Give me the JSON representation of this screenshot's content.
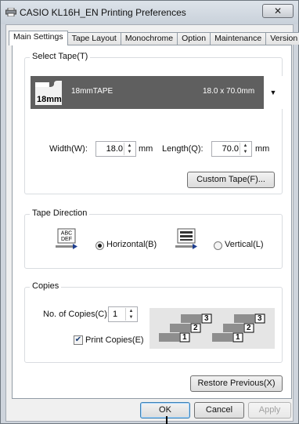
{
  "window": {
    "title": "CASIO KL16H_EN Printing Preferences",
    "close_label": "✕"
  },
  "tabs": [
    {
      "label": "Main Settings",
      "active": true
    },
    {
      "label": "Tape Layout",
      "active": false
    },
    {
      "label": "Monochrome",
      "active": false
    },
    {
      "label": "Option",
      "active": false
    },
    {
      "label": "Maintenance",
      "active": false
    },
    {
      "label": "Version",
      "active": false
    }
  ],
  "select_tape": {
    "group_label": "Select Tape(T)",
    "icon_label": "18mm",
    "tape_name": "18mmTAPE",
    "tape_size": "18.0 x 70.0mm",
    "dropdown_icon": "triangle-down"
  },
  "dimensions": {
    "width_label": "Width(W):",
    "width_value": "18.0",
    "width_unit": "mm",
    "length_label": "Length(Q):",
    "length_value": "70.0",
    "length_unit": "mm",
    "custom_tape_label": "Custom Tape(F)..."
  },
  "tape_direction": {
    "group_label": "Tape Direction",
    "horizontal_label": "Horizontal(B)",
    "vertical_label": "Vertical(L)",
    "horizontal_icon_text": "ABC\nDEF",
    "selected": "horizontal"
  },
  "copies": {
    "group_label": "Copies",
    "count_label": "No. of Copies(C):",
    "count_value": "1",
    "print_copies_label": "Print Copies(E)",
    "print_copies_checked": true,
    "illustration_numbers": [
      "3",
      "2",
      "1",
      "3",
      "2",
      "1"
    ]
  },
  "restore_label": "Restore Previous(X)",
  "footer": {
    "ok_label": "OK",
    "cancel_label": "Cancel",
    "apply_label": "Apply"
  },
  "colors": {
    "tape_bar": "#5f5f5f",
    "accent_border": "#3c7fb1"
  }
}
